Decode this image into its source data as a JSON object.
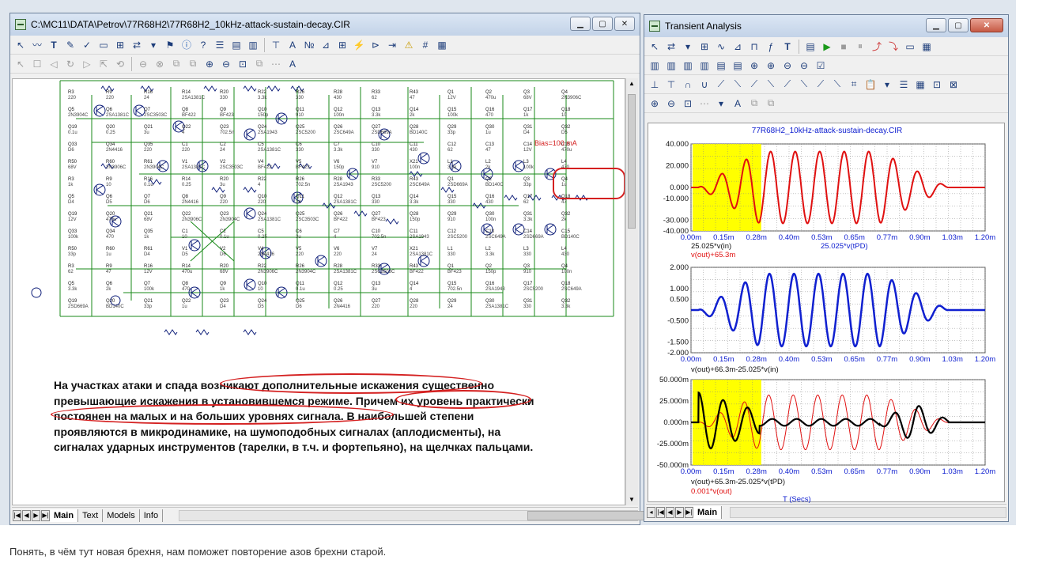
{
  "schematic_window": {
    "title": "C:\\MC11\\DATA\\Petrov\\77R68H2\\77R68H2_10kHz-attack-sustain-decay.CIR",
    "tabs": [
      "Main",
      "Text",
      "Models",
      "Info"
    ],
    "bias_label": "Bias=100 mA",
    "annotation_text": {
      "line1_a": "На участках атаки и спада",
      "line1_b": "возникают дополнительные искажения",
      "line1_c": "существенно",
      "line2_a": "превышающие искажения в установившемся режиме.",
      "line2_b": "Причем их уровень",
      "line2_c": "практически",
      "line3_a": "постоянен на малых и на больших уровнях сигнала.",
      "line3_b": "В наибольшей степени",
      "line4": "проявляются в микродинамике, на шумоподобных сигналах (аплодисменты), на",
      "line5": "сигналах ударных инструментов (тарелки, в т.ч. и фортепьяно), на щелчках пальцами."
    },
    "components": [
      "R3",
      "R9",
      "R16",
      "R14",
      "R20",
      "R22",
      "R26",
      "R28",
      "R33",
      "R43",
      "Q1",
      "Q2",
      "Q3",
      "Q4",
      "Q5",
      "Q6",
      "Q7",
      "Q8",
      "Q9",
      "Q10",
      "Q11",
      "Q12",
      "Q13",
      "Q14",
      "Q15",
      "Q16",
      "Q17",
      "Q18",
      "Q19",
      "Q20",
      "Q21",
      "Q22",
      "Q23",
      "Q24",
      "Q25",
      "Q26",
      "Q27",
      "Q28",
      "Q29",
      "Q30",
      "Q31",
      "Q32",
      "Q33",
      "Q34",
      "Q35",
      "C1",
      "C2",
      "C5",
      "C6",
      "C7",
      "C10",
      "C11",
      "C12",
      "C13",
      "C14",
      "C15",
      "R50",
      "R60",
      "R61",
      "V1",
      "V2",
      "V4",
      "V5",
      "V6",
      "V7",
      "X21",
      "L1",
      "L2",
      "L3",
      "L4"
    ],
    "component_values": [
      "220",
      "220",
      "24",
      "2SA1381C",
      "330",
      "3.3k",
      "330",
      "430",
      "62",
      "47",
      "12V",
      "470u",
      "68V",
      "2N3906C",
      "2N3904C",
      "2SA1381C",
      "2SC3503C",
      "BF422",
      "BF423",
      "150p",
      "910",
      "100n",
      "3.3k",
      "2k",
      "100k",
      "470",
      "1k",
      "10",
      "0.1u",
      "0.25",
      "3u",
      "4",
      "702.5n",
      "2SA1943",
      "2SC5200",
      "2SC649A",
      "2SD669A",
      "BD140C",
      "33p",
      "1u",
      "D4",
      "D5",
      "D6",
      "2N4416"
    ]
  },
  "transient_window": {
    "title": "Transient Analysis",
    "tab": "Main",
    "plot_title": "77R68H2_10kHz-attack-sustain-decay.CIR",
    "xlabel_bottom": "T (Secs)",
    "xticks": [
      "0.00m",
      "0.15m",
      "0.28m",
      "0.40m",
      "0.53m",
      "0.65m",
      "0.77m",
      "0.90m",
      "1.03m",
      "1.20m"
    ]
  },
  "chart_data": [
    {
      "type": "line",
      "title": "77R68H2_10kHz-attack-sustain-decay.CIR",
      "xlim": [
        0,
        0.0012
      ],
      "ylim": [
        -40,
        40
      ],
      "yticks": [
        "40.000",
        "20.000",
        "0.000",
        "-10.000",
        "-30.000",
        "-40.000"
      ],
      "xtick_labels": [
        "0.00m",
        "0.15m",
        "0.28m",
        "0.40m",
        "0.53m",
        "0.65m",
        "0.77m",
        "0.90m",
        "1.03m",
        "1.20m"
      ],
      "xlabel_left": "25.025*v(in)",
      "xlabel_right": "25.025*v(tPD)",
      "ylabel": "v(out)+65.3m",
      "highlight": {
        "x0": 0.0,
        "x1": 0.00028,
        "color": "#ffff00"
      },
      "series": [
        {
          "name": "25.025*v(in)",
          "color": "#000000",
          "description": "sine burst 10 kHz"
        },
        {
          "name": "v(out)+65.3m",
          "color": "#e01010"
        }
      ],
      "envelope": {
        "attack_end": 0.00028,
        "sustain_amp": 33,
        "decay_start": 0.00077,
        "decay_end": 0.00105,
        "freq_hz": 10000
      }
    },
    {
      "type": "line",
      "ylim": [
        -2,
        2
      ],
      "yticks": [
        "2.000",
        "1.000",
        "0.500",
        "-0.500",
        "-1.500",
        "-2.000"
      ],
      "xtick_labels": [
        "0.00m",
        "0.15m",
        "0.28m",
        "0.40m",
        "0.53m",
        "0.65m",
        "0.77m",
        "0.90m",
        "1.03m",
        "1.20m"
      ],
      "xlabel": "v(out)+66.3m-25.025*v(in)",
      "series": [
        {
          "name": "v(out)+66.3m-25.025*v(in)",
          "color": "#1020d0"
        }
      ],
      "envelope": {
        "attack_end": 0.00028,
        "sustain_amp": 1.7,
        "decay_start": 0.00077,
        "decay_end": 0.00105,
        "freq_hz": 10000
      }
    },
    {
      "type": "line",
      "ylim": [
        -50,
        50
      ],
      "yticks": [
        "50.000m",
        "25.000m",
        "0.000m",
        "-25.000m",
        "-50.000m"
      ],
      "xtick_labels": [
        "0.00m",
        "0.15m",
        "0.28m",
        "0.40m",
        "0.53m",
        "0.65m",
        "0.77m",
        "0.90m",
        "1.03m",
        "1.20m"
      ],
      "xlabel": "v(out)+65.3m-25.025*v(tPD)",
      "xlabel2": "0.001*v(out)",
      "highlight": {
        "x0": 0.0,
        "x1": 0.00028,
        "color": "#ffff00"
      },
      "series": [
        {
          "name": "v(out)+65.3m-25.025*v(tPD)",
          "color": "#000000"
        },
        {
          "name": "0.001*v(out)",
          "color": "#e01010"
        }
      ]
    }
  ],
  "footer_caption": "Понять, в чём тут новая брехня, нам поможет повторение азов брехни старой."
}
